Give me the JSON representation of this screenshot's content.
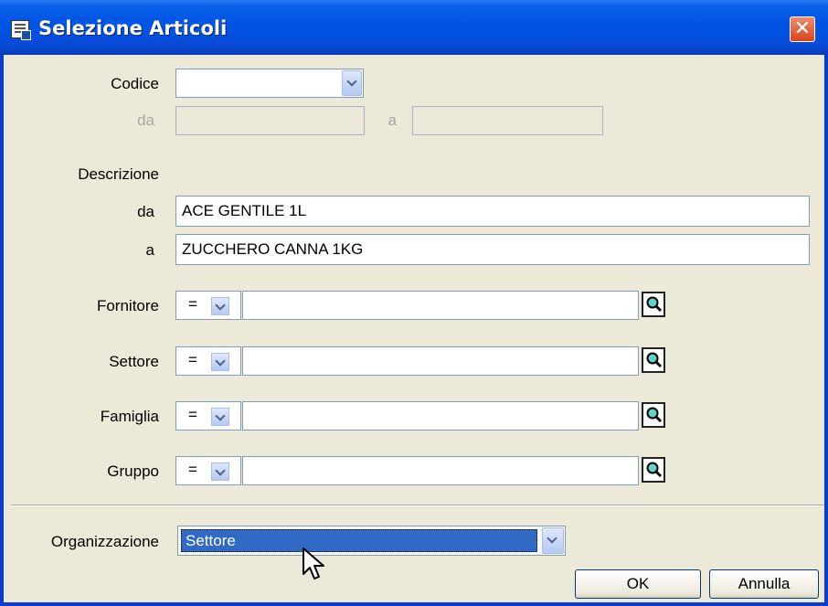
{
  "window": {
    "title": "Selezione Articoli",
    "close_label": "✕"
  },
  "codice": {
    "label": "Codice",
    "value": "",
    "da_label": "da",
    "a_label": "a",
    "da_value": "",
    "a_value": ""
  },
  "descrizione": {
    "label": "Descrizione",
    "da_label": "da",
    "da_value": "ACE GENTILE 1L",
    "a_label": "a",
    "a_value": "ZUCCHERO CANNA 1KG"
  },
  "filters": [
    {
      "label": "Fornitore",
      "operator": "=",
      "value": ""
    },
    {
      "label": "Settore",
      "operator": "=",
      "value": ""
    },
    {
      "label": "Famiglia",
      "operator": "=",
      "value": ""
    },
    {
      "label": "Gruppo",
      "operator": "=",
      "value": ""
    }
  ],
  "organizzazione": {
    "label": "Organizzazione",
    "value": "Settore"
  },
  "buttons": {
    "ok": "OK",
    "annulla": "Annulla"
  },
  "icons": {
    "title": "document-window-icon",
    "lookup": "magnifier-icon",
    "cursor": "mouse-pointer-icon"
  }
}
